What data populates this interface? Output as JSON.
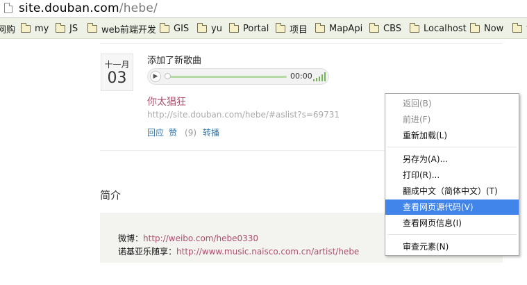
{
  "urlbar": {
    "host": "site.douban.com",
    "path": "/hebe/"
  },
  "bookmarks": [
    {
      "label": "网购",
      "folder": false
    },
    {
      "label": "my",
      "folder": true
    },
    {
      "label": "JS",
      "folder": true
    },
    {
      "label": "web前端开发",
      "folder": true
    },
    {
      "label": "GIS",
      "folder": true
    },
    {
      "label": "yu",
      "folder": true
    },
    {
      "label": "Portal",
      "folder": true
    },
    {
      "label": "项目",
      "folder": true
    },
    {
      "label": "MapApi",
      "folder": true
    },
    {
      "label": "CBS",
      "folder": true
    },
    {
      "label": "Localhost",
      "folder": true
    },
    {
      "label": "Now",
      "folder": true
    },
    {
      "label": "v",
      "folder": true
    }
  ],
  "feed": {
    "month": "十一月",
    "day": "03",
    "title": "添加了新歌曲",
    "player": {
      "time": "00:00",
      "play_icon": "play-icon",
      "volume_icon": "volume-bars-icon",
      "progress": 0
    },
    "song_title": "你太猖狂",
    "song_url": "http://site.douban.com/hebe/#aslist?s=69731",
    "actions": {
      "reply": "回应",
      "like": "赞",
      "like_count": "(9)",
      "share": "转播"
    }
  },
  "intro": {
    "heading": "简介",
    "weibo_label": "微博：",
    "weibo_url": "http://weibo.com/hebe0330",
    "nokia_label": "诺基亚乐随享：",
    "nokia_url": "http://www.music.naisco.com.cn/artist/hebe"
  },
  "context_menu": {
    "items": [
      {
        "label": "返回(B)",
        "disabled": true
      },
      {
        "label": "前进(F)",
        "disabled": true
      },
      {
        "label": "重新加载(L)",
        "disabled": false
      },
      {
        "label": "另存为(A)...",
        "disabled": false
      },
      {
        "label": "打印(R)...",
        "disabled": false
      },
      {
        "label": "翻成中文（简体中文）(T)",
        "disabled": false
      },
      {
        "label": "查看网页源代码(V)",
        "disabled": false,
        "highlighted": true
      },
      {
        "label": "查看网页信息(I)",
        "disabled": false
      },
      {
        "label": "审查元素(N)",
        "disabled": false
      }
    ]
  },
  "colors": {
    "highlight": "#4285ea",
    "link_pink": "#aa5070",
    "link_blue": "#3377aa",
    "bookmark_bar": "#eef2e6"
  }
}
